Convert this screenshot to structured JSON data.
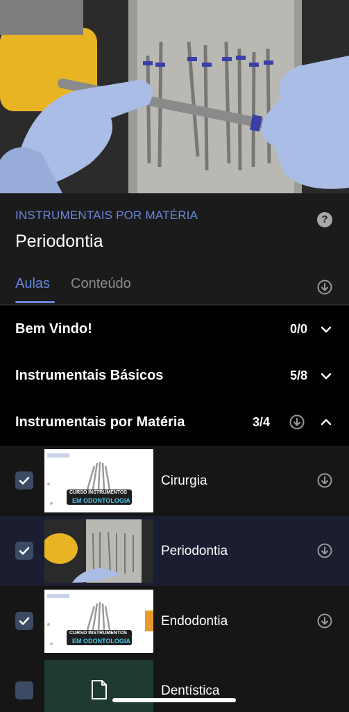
{
  "header": {
    "eyebrow": "INSTRUMENTAIS POR MATÉRIA",
    "title": "Periodontia",
    "help_symbol": "?"
  },
  "tabs": [
    {
      "label": "Aulas",
      "active": true
    },
    {
      "label": "Conteúdo",
      "active": false
    }
  ],
  "sections": [
    {
      "title": "Bem Vindo!",
      "count": "0/0",
      "expanded": false
    },
    {
      "title": "Instrumentais Básicos",
      "count": "5/8",
      "expanded": false
    },
    {
      "title": "Instrumentais por Matéria",
      "count": "3/4",
      "expanded": true
    }
  ],
  "lessons": [
    {
      "label": "Cirurgia",
      "completed": true,
      "thumb_caption": [
        "CURSO INSTRUMENTOS",
        "EM ODONTOLOGIA"
      ]
    },
    {
      "label": "Periodontia",
      "completed": true,
      "active": true
    },
    {
      "label": "Endodontia",
      "completed": true,
      "thumb_caption": [
        "CURSO INSTRUMENTOS",
        "EM ODONTOLOGIA"
      ]
    },
    {
      "label": "Dentística",
      "completed": false
    }
  ],
  "colors": {
    "accent": "#6b86dd",
    "checkbox": "#3d4a63",
    "active_row": "#1a1e30"
  }
}
